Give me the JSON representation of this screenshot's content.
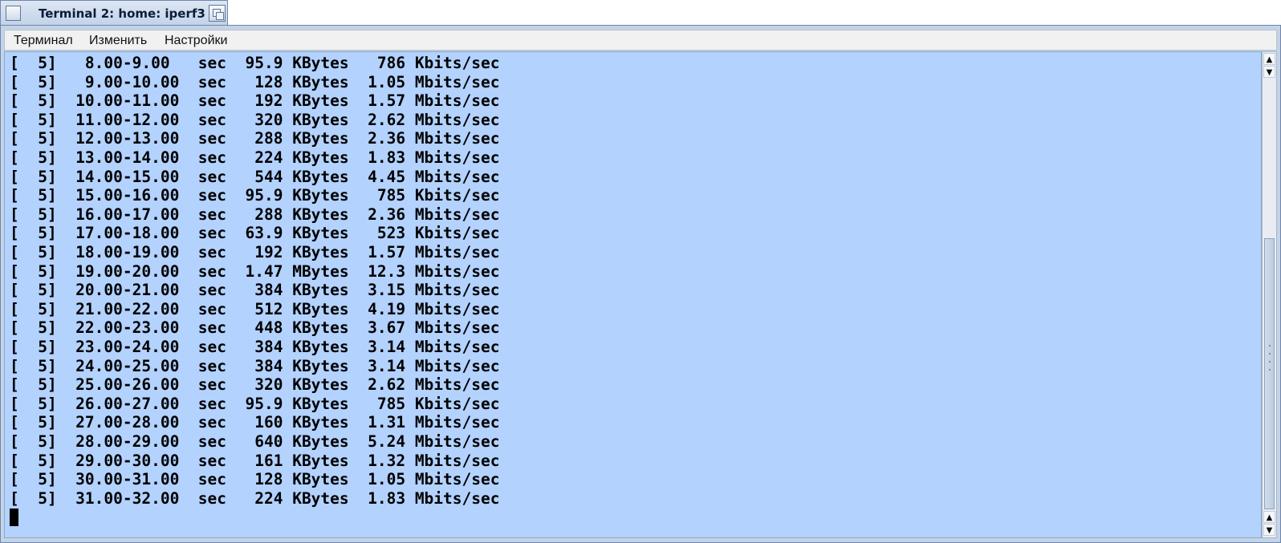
{
  "window": {
    "title": "Terminal 2: home: iperf3"
  },
  "menu": [
    "Терминал",
    "Изменить",
    "Настройки"
  ],
  "terminal": {
    "lines": [
      "[  5]   8.00-9.00   sec  95.9 KBytes   786 Kbits/sec",
      "[  5]   9.00-10.00  sec   128 KBytes  1.05 Mbits/sec",
      "[  5]  10.00-11.00  sec   192 KBytes  1.57 Mbits/sec",
      "[  5]  11.00-12.00  sec   320 KBytes  2.62 Mbits/sec",
      "[  5]  12.00-13.00  sec   288 KBytes  2.36 Mbits/sec",
      "[  5]  13.00-14.00  sec   224 KBytes  1.83 Mbits/sec",
      "[  5]  14.00-15.00  sec   544 KBytes  4.45 Mbits/sec",
      "[  5]  15.00-16.00  sec  95.9 KBytes   785 Kbits/sec",
      "[  5]  16.00-17.00  sec   288 KBytes  2.36 Mbits/sec",
      "[  5]  17.00-18.00  sec  63.9 KBytes   523 Kbits/sec",
      "[  5]  18.00-19.00  sec   192 KBytes  1.57 Mbits/sec",
      "[  5]  19.00-20.00  sec  1.47 MBytes  12.3 Mbits/sec",
      "[  5]  20.00-21.00  sec   384 KBytes  3.15 Mbits/sec",
      "[  5]  21.00-22.00  sec   512 KBytes  4.19 Mbits/sec",
      "[  5]  22.00-23.00  sec   448 KBytes  3.67 Mbits/sec",
      "[  5]  23.00-24.00  sec   384 KBytes  3.14 Mbits/sec",
      "[  5]  24.00-25.00  sec   384 KBytes  3.14 Mbits/sec",
      "[  5]  25.00-26.00  sec   320 KBytes  2.62 Mbits/sec",
      "[  5]  26.00-27.00  sec  95.9 KBytes   785 Kbits/sec",
      "[  5]  27.00-28.00  sec   160 KBytes  1.31 Mbits/sec",
      "[  5]  28.00-29.00  sec   640 KBytes  5.24 Mbits/sec",
      "[  5]  29.00-30.00  sec   161 KBytes  1.32 Mbits/sec",
      "[  5]  30.00-31.00  sec   128 KBytes  1.05 Mbits/sec",
      "[  5]  31.00-32.00  sec   224 KBytes  1.83 Mbits/sec"
    ]
  },
  "colors": {
    "terminal_bg": "#b3d2fe",
    "titlebar": "#c3d3e8"
  },
  "icons": {
    "scroll_up": "▲",
    "scroll_down": "▼"
  }
}
